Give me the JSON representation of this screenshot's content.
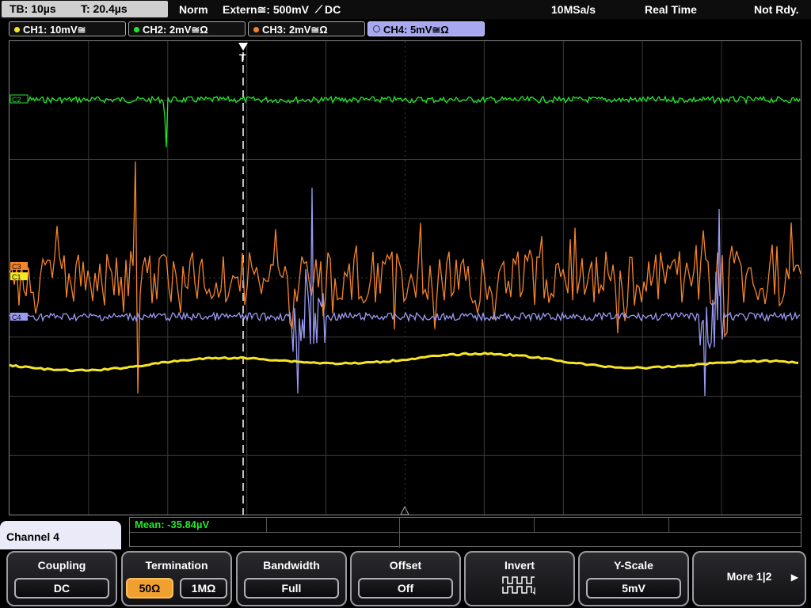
{
  "topbar": {
    "timebase": "TB: 10µs",
    "trigger_time": "T: 20.4µs",
    "trigger_mode": "Norm",
    "trigger_source": "Extern≅: 500mV",
    "trigger_slope_coupling": "DC",
    "sample_rate": "10MSa/s",
    "acq_mode": "Real Time",
    "status": "Not Rdy."
  },
  "channels": [
    {
      "label": "CH1: 10mV≅",
      "color": "#f5e626"
    },
    {
      "label": "CH2: 2mV≅Ω",
      "color": "#23e62a"
    },
    {
      "label": "CH3: 2mV≅Ω",
      "color": "#f5832a"
    },
    {
      "label": "CH4: 5mV≅Ω",
      "color": "#9a9af5",
      "active": true
    }
  ],
  "markers": {
    "trigger": "T",
    "ch1": "C1",
    "ch2": "C2",
    "ch3": "C3",
    "ch4": "C4"
  },
  "measurement": {
    "text": "Mean: -35.84µV"
  },
  "menu_title": "Channel 4",
  "softkeys": {
    "coupling": {
      "title": "Coupling",
      "value": "DC"
    },
    "termination": {
      "title": "Termination",
      "options": [
        "50Ω",
        "1MΩ"
      ],
      "selected": "50Ω"
    },
    "bandwidth": {
      "title": "Bandwidth",
      "value": "Full"
    },
    "offset": {
      "title": "Offset",
      "value": "Off"
    },
    "invert": {
      "title": "Invert"
    },
    "yscale": {
      "title": "Y-Scale",
      "value": "5mV"
    },
    "more": {
      "label": "More 1|2"
    }
  },
  "icons": [
    "play-right-icon",
    "square-wave-icon",
    "inverted-square-wave-icon",
    "trigger-arrow-icon"
  ]
}
